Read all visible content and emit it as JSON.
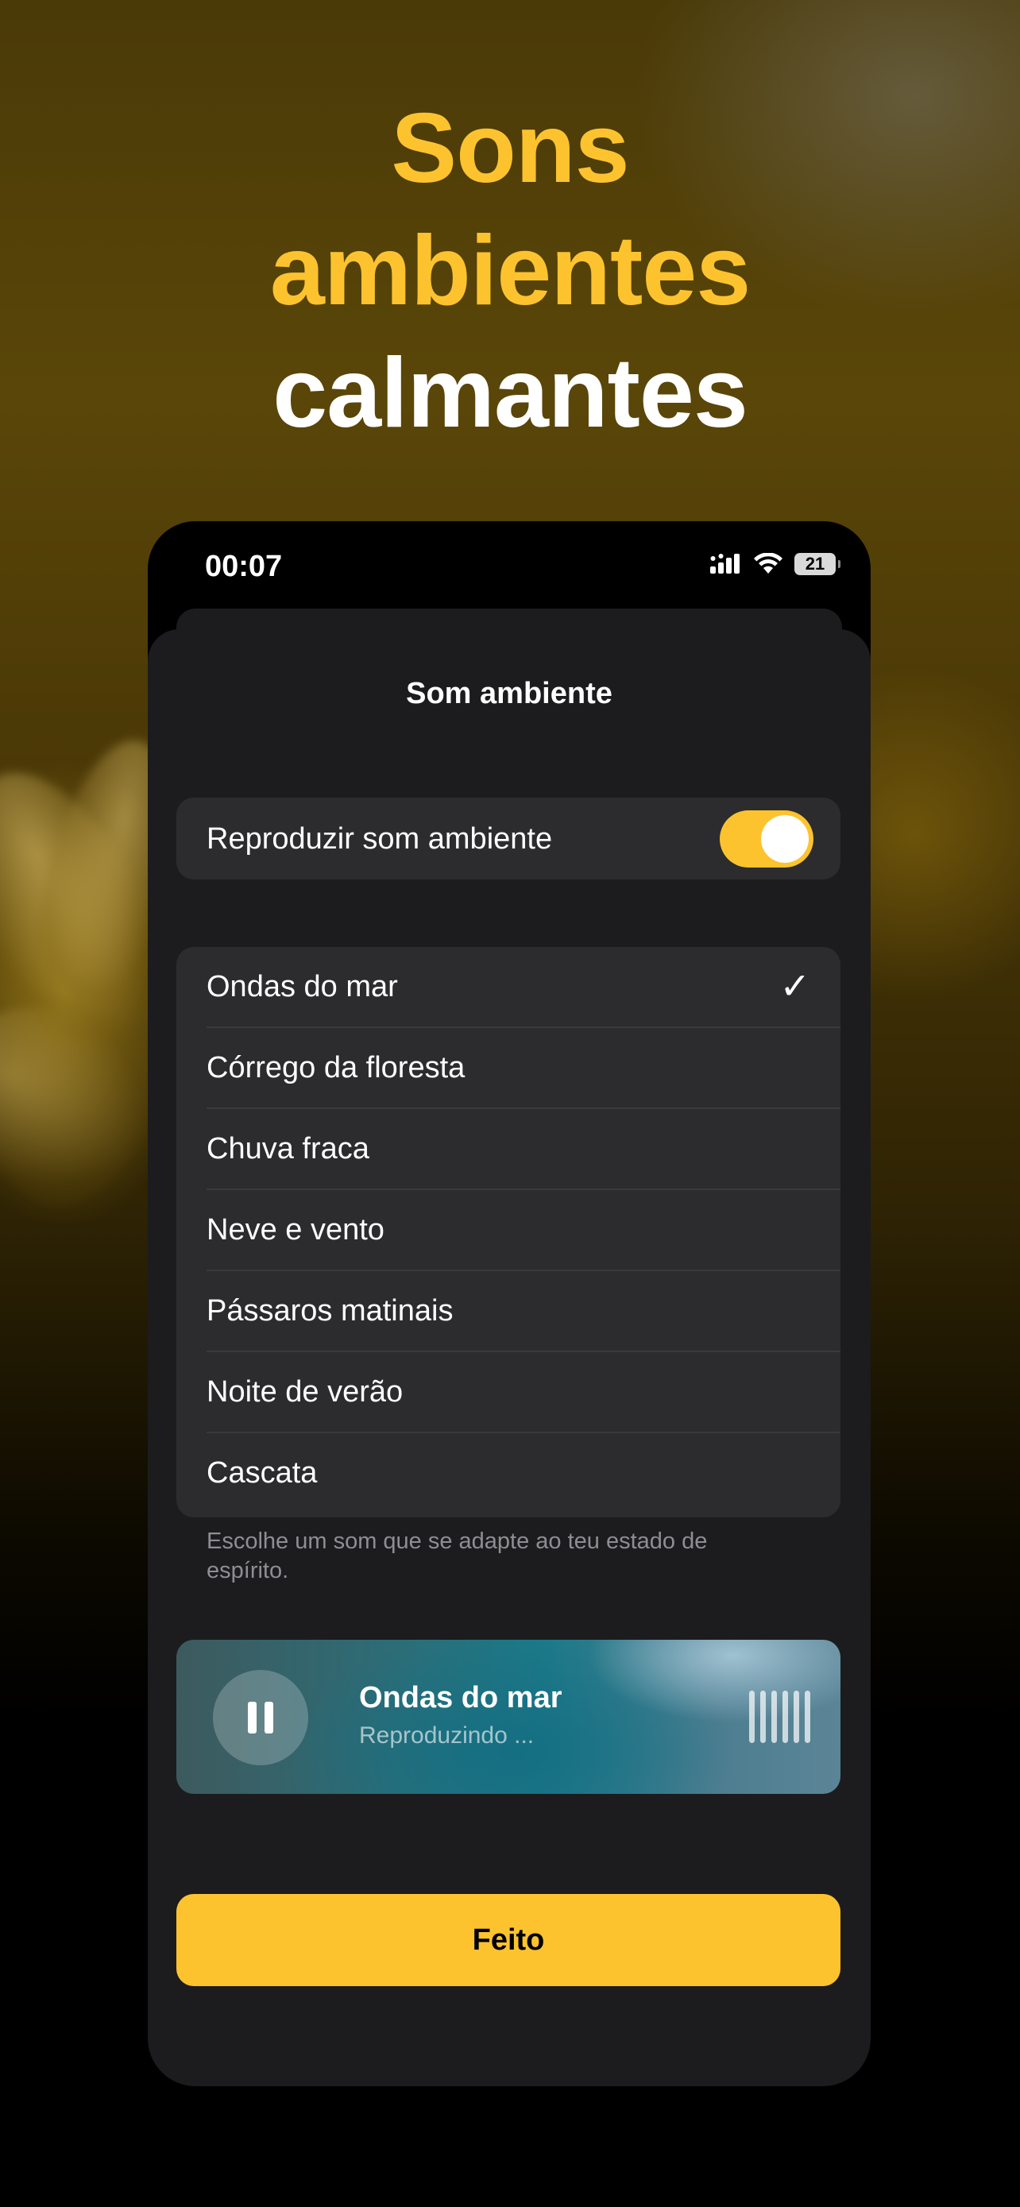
{
  "hero": {
    "line1": "Sons",
    "line2": "ambientes",
    "line3": "calmantes"
  },
  "status_bar": {
    "time": "00:07",
    "battery": "21"
  },
  "sheet": {
    "title": "Som ambiente",
    "toggle_label": "Reproduzir som ambiente",
    "toggle_on": true
  },
  "sounds": {
    "items": [
      {
        "label": "Ondas do mar",
        "selected": true
      },
      {
        "label": "Córrego da floresta",
        "selected": false
      },
      {
        "label": "Chuva fraca",
        "selected": false
      },
      {
        "label": "Neve e vento",
        "selected": false
      },
      {
        "label": "Pássaros matinais",
        "selected": false
      },
      {
        "label": "Noite de verão",
        "selected": false
      },
      {
        "label": "Cascata",
        "selected": false
      }
    ],
    "check_mark": "✓",
    "footnote": "Escolhe um som que se adapte ao teu estado de espírito."
  },
  "player": {
    "title": "Ondas do mar",
    "subtitle": "Reproduzindo ..."
  },
  "done_label": "Feito",
  "colors": {
    "accent": "#fdc32f",
    "sheet_bg": "#1c1c1e",
    "row_bg": "#2c2c2e"
  }
}
